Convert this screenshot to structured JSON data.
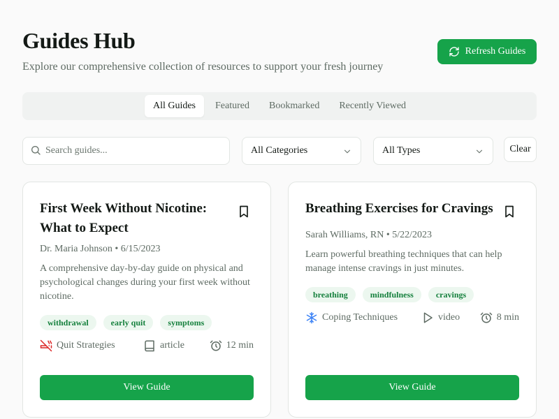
{
  "header": {
    "title": "Guides Hub",
    "subtitle": "Explore our comprehensive collection of resources to support your fresh journey",
    "refresh_label": "Refresh Guides"
  },
  "tabs": [
    {
      "label": "All Guides",
      "active": true
    },
    {
      "label": "Featured",
      "active": false
    },
    {
      "label": "Bookmarked",
      "active": false
    },
    {
      "label": "Recently Viewed",
      "active": false
    }
  ],
  "filters": {
    "search_placeholder": "Search guides...",
    "category_selected": "All Categories",
    "type_selected": "All Types",
    "clear_label": "Clear"
  },
  "guides": [
    {
      "title": "First Week Without Nicotine: What to Expect",
      "author_date": "Dr. Maria Johnson • 6/15/2023",
      "description": "A comprehensive day-by-day guide on physical and psychological changes during your first week without nicotine.",
      "tags": [
        "withdrawal",
        "early quit",
        "symptoms"
      ],
      "category": "Quit Strategies",
      "category_icon": "no-smoking-icon",
      "type": "article",
      "type_icon": "book-icon",
      "duration": "12 min",
      "button_label": "View Guide"
    },
    {
      "title": "Breathing Exercises for Cravings",
      "author_date": "Sarah Williams, RN • 5/22/2023",
      "description": "Learn powerful breathing techniques that can help manage intense cravings in just minutes.",
      "tags": [
        "breathing",
        "mindfulness",
        "cravings"
      ],
      "category": "Coping Techniques",
      "category_icon": "snowflake-icon",
      "type": "video",
      "type_icon": "play-icon",
      "duration": "8 min",
      "button_label": "View Guide"
    }
  ],
  "colors": {
    "accent": "#16a34a",
    "tag_bg": "#ecf7ef",
    "tag_text": "#15803d",
    "quit_icon": "#dc2626",
    "coping_icon": "#3b82f6"
  }
}
